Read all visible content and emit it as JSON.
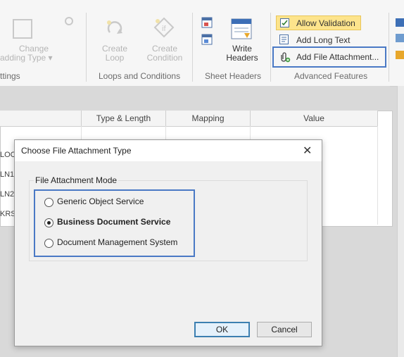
{
  "ribbon": {
    "settings_group": {
      "change_padding_label_1": "Change",
      "change_padding_label_2": "adding Type ▾",
      "group_label": "ttings"
    },
    "loops_group": {
      "create_loop_1": "Create",
      "create_loop_2": "Loop",
      "create_condition_1": "Create",
      "create_condition_2": "Condition",
      "group_label": "Loops and Conditions"
    },
    "sheet_headers_group": {
      "write_headers_1": "Write",
      "write_headers_2": "Headers",
      "group_label": "Sheet Headers"
    },
    "advanced_group": {
      "allow_validation": "Allow Validation",
      "add_long_text": "Add Long Text",
      "add_file_attachment": "Add File Attachment...",
      "group_label": "Advanced Features"
    }
  },
  "grid": {
    "headers": [
      "Type & Length",
      "Mapping",
      "Value"
    ],
    "row_fragments": [
      "LOC",
      "LN1",
      "LN2",
      "KRS"
    ]
  },
  "dialog": {
    "title": "Choose File Attachment Type",
    "close": "✕",
    "group_title": "File Attachment Mode",
    "options": [
      {
        "label": "Generic Object Service",
        "selected": false
      },
      {
        "label": "Business Document Service",
        "selected": true
      },
      {
        "label": "Document Management System",
        "selected": false
      }
    ],
    "ok": "OK",
    "cancel": "Cancel"
  },
  "colors": {
    "highlight_border": "#4a79c5",
    "allow_validation_bg": "#fde48c"
  }
}
